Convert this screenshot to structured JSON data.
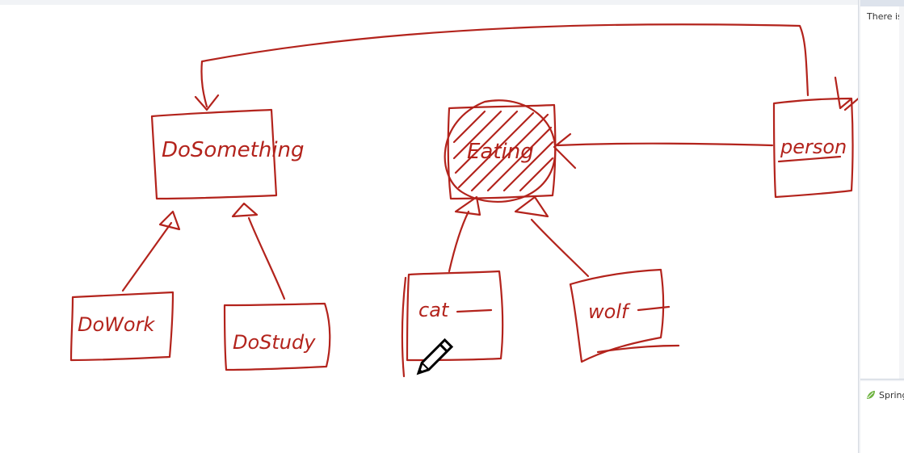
{
  "diagram": {
    "ink_color": "#b3231c",
    "nodes": {
      "dosomething": {
        "label": "DoSomething"
      },
      "dowork": {
        "label": "DoWork"
      },
      "dostudy": {
        "label": "DoStudy"
      },
      "eating": {
        "label": "Eating"
      },
      "cat": {
        "label": "cat"
      },
      "wolf": {
        "label": "wolf"
      },
      "person": {
        "label": "person"
      }
    }
  },
  "side_panel": {
    "message": "There is no",
    "spring_label": "Spring",
    "spring_icon": "spring-leaf-icon"
  },
  "cursor": {
    "icon": "pencil-cursor-icon"
  }
}
